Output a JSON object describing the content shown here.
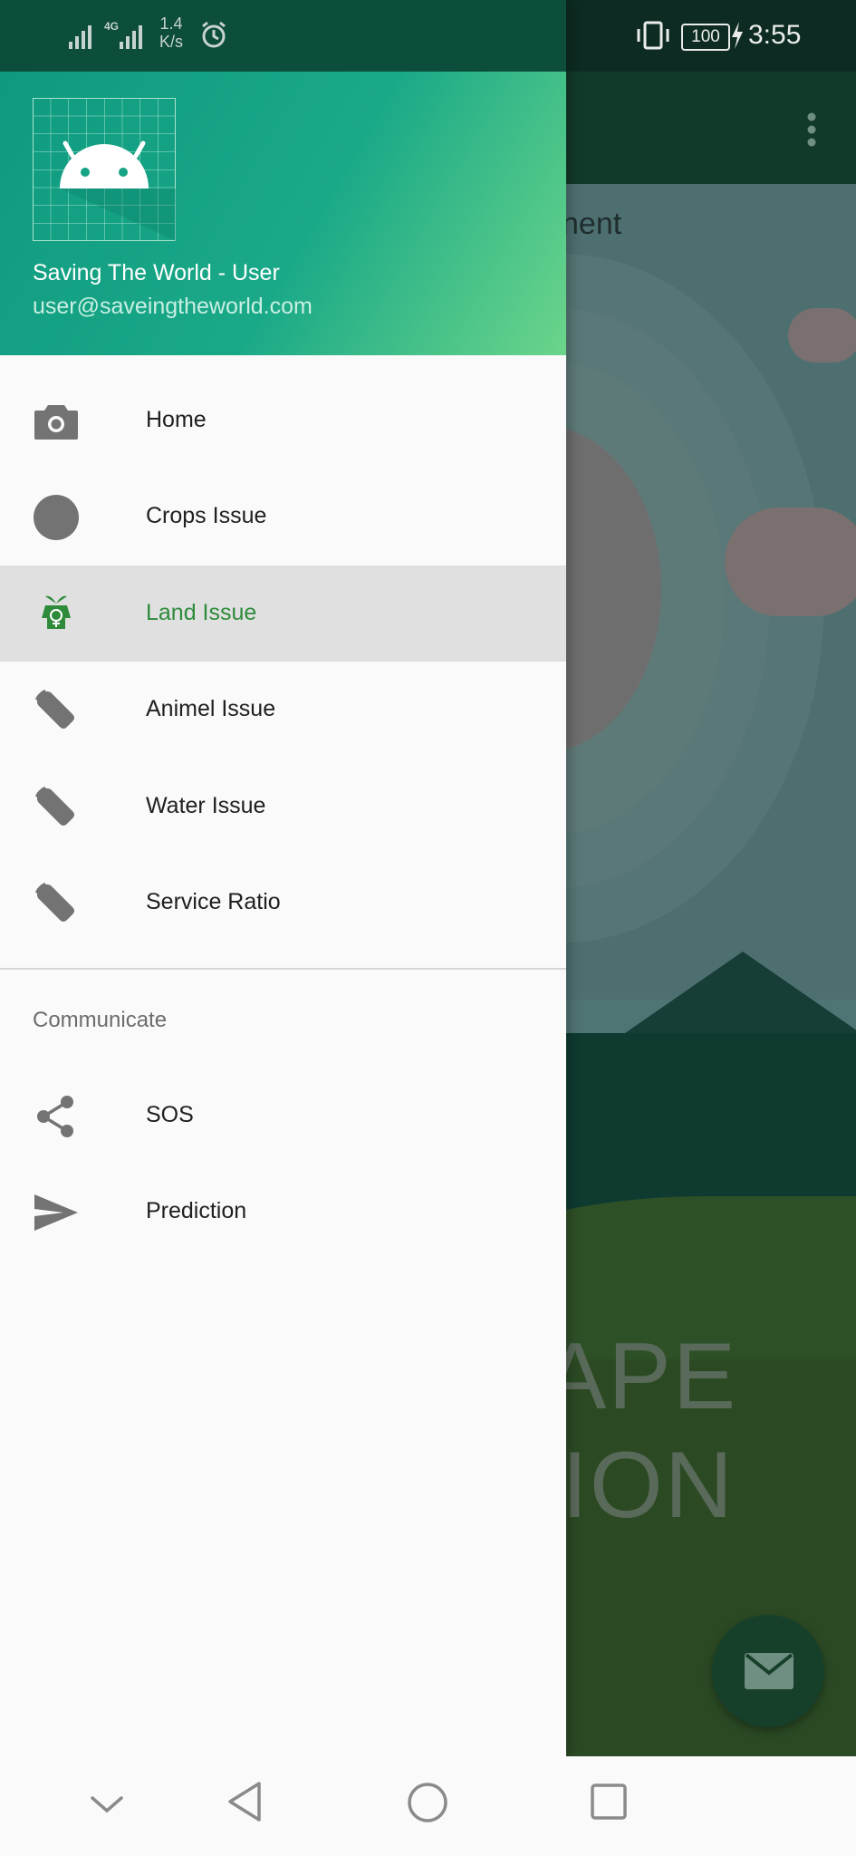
{
  "status_bar": {
    "net_speed_value": "1.4",
    "net_speed_unit": "K/s",
    "battery": "100",
    "time": "3:55",
    "network_label": "4G"
  },
  "background": {
    "header_fragment": "nent",
    "title_line1": "APE",
    "title_line2": "ION",
    "fab_icon": "mail-icon"
  },
  "drawer": {
    "user_name": "Saving The World - User",
    "user_email": "user@saveingtheworld.com",
    "items": [
      {
        "label": "Home",
        "icon": "camera-icon"
      },
      {
        "label": "Crops Issue",
        "icon": "circle-icon"
      },
      {
        "label": "Land Issue",
        "icon": "land-icon",
        "active": true
      },
      {
        "label": "Animel Issue",
        "icon": "wrench-icon"
      },
      {
        "label": "Water Issue",
        "icon": "wrench-icon"
      },
      {
        "label": "Service Ratio",
        "icon": "wrench-icon"
      }
    ],
    "section_title": "Communicate",
    "communicate_items": [
      {
        "label": "SOS",
        "icon": "share-icon"
      },
      {
        "label": "Prediction",
        "icon": "send-icon"
      }
    ]
  },
  "colors": {
    "accent_active": "#2e8b3a",
    "header_start": "#0f9a80",
    "header_end": "#6bd58a",
    "icon_gray": "#737373"
  }
}
